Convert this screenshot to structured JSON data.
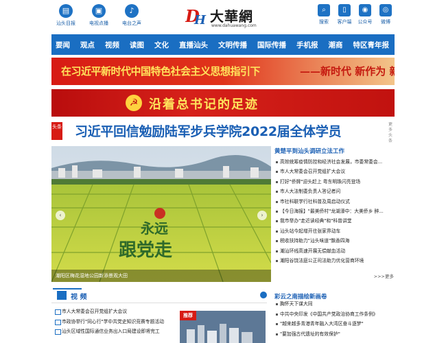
{
  "header": {
    "logo_text": "大華網",
    "logo_sub": "www.dahuawang.com",
    "left_icons": [
      {
        "label": "汕头目报",
        "icon": "newspaper-icon",
        "glyph": "▤"
      },
      {
        "label": "电视点播",
        "icon": "tv-icon",
        "glyph": "▣"
      },
      {
        "label": "电台之声",
        "icon": "microphone-icon",
        "glyph": "♪"
      }
    ],
    "right_icons": [
      {
        "label": "搜索",
        "icon": "search-icon",
        "glyph": "⌕"
      },
      {
        "label": "客户端",
        "icon": "phone-icon",
        "glyph": "▯"
      },
      {
        "label": "公众号",
        "icon": "wechat-icon",
        "glyph": "◉"
      },
      {
        "label": "微博",
        "icon": "weibo-icon",
        "glyph": "◎"
      }
    ]
  },
  "nav": [
    "要闻",
    "观点",
    "视频",
    "读图",
    "文化",
    "直播汕头",
    "文明传播",
    "国际传播",
    "手机报",
    "潮商",
    "特区青年报"
  ],
  "banner1": {
    "main": "在习近平新时代中国特色社会主义思想指引下",
    "tail": "——新时代 新作为 新篇章"
  },
  "banner2": {
    "text": "沿着总书记的足迹",
    "emblem": "☭"
  },
  "headline": {
    "tag": "头条",
    "title": "习近平回信勉励陆军步兵学院2022届全体学员",
    "side": "更多头条"
  },
  "hero": {
    "caption": "潮阳区梅花湿地公园新添景观大田",
    "prev": "‹",
    "next": "›",
    "field_text_1": "永远",
    "field_text_2": "跟党走"
  },
  "news": {
    "title": "黄楚平到汕头调研立法工作",
    "items": [
      "高效统筹疫情防控和经济社会发展，市委常委会...",
      "市人大常委会召开党组扩大会议",
      "打好\"侨牌\"迎头赶上 粤东明珠闪亮登场",
      "市人大法制委负责人答记者问",
      "市社科联学行社科普及周启动仪式",
      "【今日海报】\"最美侨村\"龙湖濠中：大美侨乡 醉...",
      "我市举办\"走近读经典\"和\"科普讲堂",
      "汕头站今起增开往张家界动车",
      "税收扶持助力\"汕头味道\"飘香四海",
      "潮汕环线高速开展无偿献血活动",
      "潮阳谷饶法庭公正司法助力优化营商环境"
    ],
    "more": ">>>更多"
  },
  "video": {
    "label": "视 频",
    "items": [
      "市人大常委会召开党组扩大会议",
      "市政协举行\"同心行\"学中共党史知识竞赛专题活动",
      "汕头区域性国际通信业务出入口局建设即将完工"
    ],
    "recommend_tag": "推荐"
  },
  "lower_right": {
    "title": "彩云之南描绘新画卷",
    "items": [
      "胸怀天下谋大同",
      "中共中央印发《中国共产党政治协商工作条例》",
      "\"越来越多青港青年融入大湾区奋斗逐梦\"",
      "\"要加强古代遗址的有效保护\""
    ]
  }
}
